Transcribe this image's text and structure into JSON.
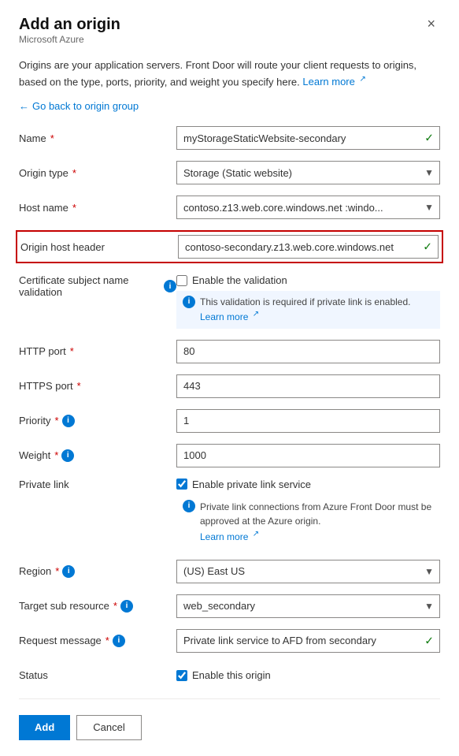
{
  "panel": {
    "title": "Add an origin",
    "subtitle": "Microsoft Azure",
    "close_label": "×"
  },
  "description": {
    "text": "Origins are your application servers. Front Door will route your client requests to origins, based on the type, ports, priority, and weight you specify here.",
    "learn_more": "Learn more"
  },
  "back_link": "Go back to origin group",
  "fields": {
    "name": {
      "label": "Name",
      "required": true,
      "value": "myStorageStaticWebsite-secondary",
      "has_check": true
    },
    "origin_type": {
      "label": "Origin type",
      "required": true,
      "value": "Storage (Static website)"
    },
    "host_name": {
      "label": "Host name",
      "required": true,
      "value": "contoso.z13.web.core.windows.net  :windo..."
    },
    "origin_host_header": {
      "label": "Origin host header",
      "value": "contoso-secondary.z13.web.core.windows.net",
      "has_check": true
    },
    "cert_validation": {
      "label": "Certificate subject name validation",
      "checkbox_label": "Enable the validation",
      "checked": false,
      "note": "This validation is required if private link is enabled.",
      "learn_more": "Learn more"
    },
    "http_port": {
      "label": "HTTP port",
      "required": true,
      "value": "80"
    },
    "https_port": {
      "label": "HTTPS port",
      "required": true,
      "value": "443"
    },
    "priority": {
      "label": "Priority",
      "required": true,
      "value": "1",
      "has_info": true
    },
    "weight": {
      "label": "Weight",
      "required": true,
      "value": "1000",
      "has_info": true
    },
    "private_link": {
      "label": "Private link",
      "checkbox_label": "Enable private link service",
      "checked": true,
      "note": "Private link connections from Azure Front Door must be approved at the Azure origin.",
      "learn_more": "Learn more"
    },
    "region": {
      "label": "Region",
      "required": true,
      "has_info": true,
      "value": "(US) East US"
    },
    "target_sub_resource": {
      "label": "Target sub resource",
      "required": true,
      "has_info": true,
      "value": "web_secondary"
    },
    "request_message": {
      "label": "Request message",
      "required": true,
      "has_info": true,
      "value": "Private link service to AFD from secondary",
      "has_check": true
    },
    "status": {
      "label": "Status",
      "checkbox_label": "Enable this origin",
      "checked": true
    }
  },
  "footer": {
    "add_label": "Add",
    "cancel_label": "Cancel"
  }
}
